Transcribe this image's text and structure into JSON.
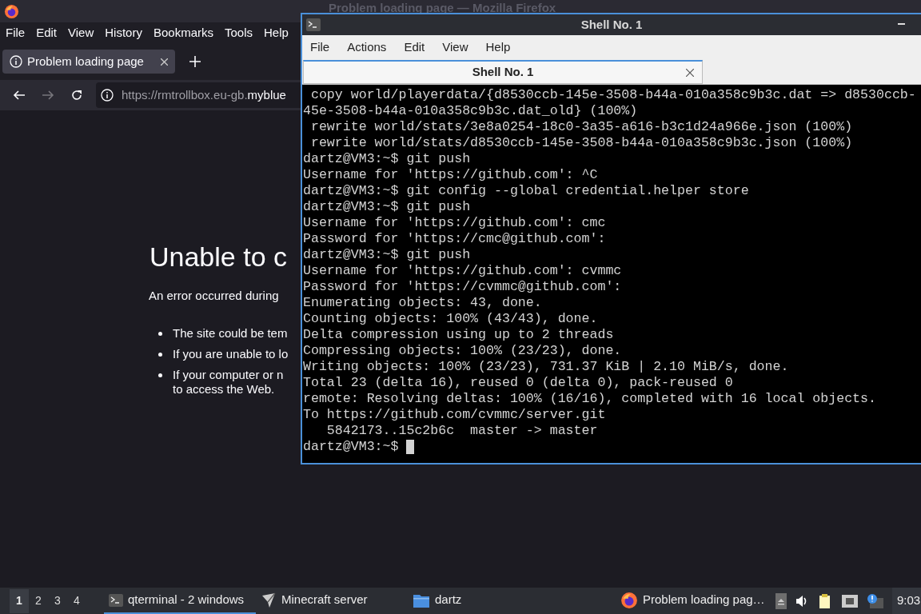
{
  "browser": {
    "title": "Problem loading page — Mozilla Firefox",
    "menu": [
      "File",
      "Edit",
      "View",
      "History",
      "Bookmarks",
      "Tools",
      "Help"
    ],
    "tabs": [
      {
        "label": "Problem loading page",
        "selected": true
      }
    ],
    "url": {
      "prefix": "https://rmtrollbox.eu-gb.",
      "domain": "myblue"
    },
    "page": {
      "heading": "Unable to c",
      "intro": "An error occurred during",
      "bullets": [
        [
          "The site could be tem"
        ],
        [
          "If you are unable to lo"
        ],
        [
          "If your computer or n",
          "to access the Web."
        ]
      ]
    }
  },
  "terminal": {
    "title": "Shell No. 1",
    "menu": [
      "File",
      "Actions",
      "Edit",
      "View",
      "Help"
    ],
    "tabs": [
      {
        "label": "Shell No. 1",
        "selected": true
      }
    ],
    "lines": [
      " copy world/playerdata/{d8530ccb-145e-3508-b44a-010a358c9b3c.dat => d8530ccb-",
      "45e-3508-b44a-010a358c9b3c.dat_old} (100%)",
      " rewrite world/stats/3e8a0254-18c0-3a35-a616-b3c1d24a966e.json (100%)",
      " rewrite world/stats/d8530ccb-145e-3508-b44a-010a358c9b3c.json (100%)",
      "dartz@VM3:~$ git push",
      "Username for 'https://github.com': ^C",
      "dartz@VM3:~$ git config --global credential.helper store",
      "dartz@VM3:~$ git push",
      "Username for 'https://github.com': cmc",
      "Password for 'https://cmc@github.com':",
      "dartz@VM3:~$ git push",
      "Username for 'https://github.com': cvmmc",
      "Password for 'https://cvmmc@github.com':",
      "Enumerating objects: 43, done.",
      "Counting objects: 100% (43/43), done.",
      "Delta compression using up to 2 threads",
      "Compressing objects: 100% (23/23), done.",
      "Writing objects: 100% (23/23), 731.37 KiB | 2.10 MiB/s, done.",
      "Total 23 (delta 16), reused 0 (delta 0), pack-reused 0",
      "remote: Resolving deltas: 100% (16/16), completed with 16 local objects.",
      "To https://github.com/cvmmc/server.git",
      "   5842173..15c2b6c  master -> master"
    ],
    "prompt": "dartz@VM3:~$ "
  },
  "taskbar": {
    "workspaces": [
      {
        "label": "1",
        "selected": true
      },
      {
        "label": "2",
        "selected": false
      },
      {
        "label": "3",
        "selected": false
      },
      {
        "label": "4",
        "selected": false
      }
    ],
    "tasks": [
      {
        "kind": "terminal",
        "label": "qterminal - 2 windows",
        "selected": true
      },
      {
        "kind": "plane",
        "label": "Minecraft server",
        "selected": false
      },
      {
        "kind": "folder",
        "label": "dartz",
        "selected": false
      },
      {
        "kind": "firefox",
        "label": "Problem loading pag…",
        "selected": false
      }
    ],
    "clock": "9:03"
  }
}
